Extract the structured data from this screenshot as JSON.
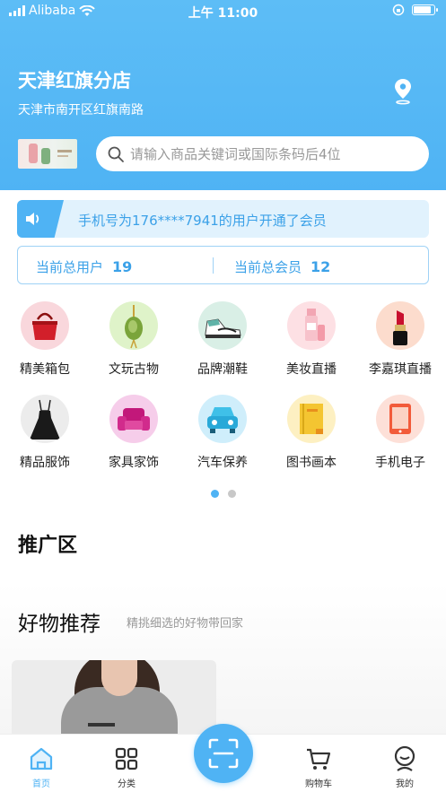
{
  "status_bar": {
    "carrier": "Alibaba",
    "time": "上午 11:00",
    "battery_level": 0.9
  },
  "store": {
    "name": "天津红旗分店",
    "address": "天津市南开区红旗南路"
  },
  "search": {
    "placeholder": "请输入商品关键词或国际条码后4位"
  },
  "notice": {
    "text": "手机号为176****7941的用户开通了会员"
  },
  "stats": {
    "users_label": "当前总用户",
    "users_value": "19",
    "members_label": "当前总会员",
    "members_value": "12"
  },
  "categories": [
    {
      "label": "精美箱包",
      "icon": "handbag-icon"
    },
    {
      "label": "文玩古物",
      "icon": "jade-pendant-icon"
    },
    {
      "label": "品牌潮鞋",
      "icon": "sneaker-icon"
    },
    {
      "label": "美妆直播",
      "icon": "cosmetics-icon"
    },
    {
      "label": "李嘉琪直播",
      "icon": "lipstick-icon"
    },
    {
      "label": "精品服饰",
      "icon": "dress-icon"
    },
    {
      "label": "家具家饰",
      "icon": "sofa-icon"
    },
    {
      "label": "汽车保养",
      "icon": "car-icon"
    },
    {
      "label": "图书画本",
      "icon": "notebook-icon"
    },
    {
      "label": "手机电子",
      "icon": "tablet-icon"
    }
  ],
  "pager": {
    "pages": 2,
    "current": 1
  },
  "promo": {
    "title": "推广区"
  },
  "recommend": {
    "title": "好物推荐",
    "subtitle": "精挑细选的好物带回家"
  },
  "tabbar": {
    "items": [
      {
        "label": "首页",
        "icon": "home-icon",
        "active": true
      },
      {
        "label": "分类",
        "icon": "category-grid-icon",
        "active": false
      },
      {
        "label": "",
        "icon": "scan-icon",
        "active": false
      },
      {
        "label": "购物车",
        "icon": "cart-icon",
        "active": false
      },
      {
        "label": "我的",
        "icon": "profile-icon",
        "active": false
      }
    ]
  },
  "colors": {
    "primary": "#4fb3f4",
    "notice_bg": "#e1f2fd",
    "accent_text": "#3ba1e8"
  }
}
